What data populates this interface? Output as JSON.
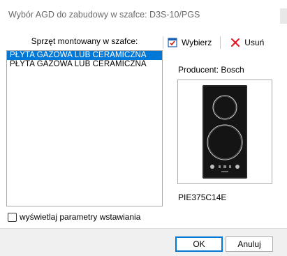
{
  "window": {
    "title": "Wybór AGD do zabudowy w szafce: D3S-10/PGS"
  },
  "left_panel": {
    "header": "Sprzęt montowany w szafce:",
    "items": [
      {
        "label": "PŁYTA GAZOWA LUB CERAMICZNA",
        "selected": true
      },
      {
        "label": "PŁYTA GAZOWA LUB CERAMICZNA",
        "selected": false
      }
    ],
    "checkbox_label": "wyświetlaj parametry wstawiania",
    "checkbox_checked": false
  },
  "toolbar": {
    "select_label": "Wybierz",
    "delete_label": "Usuń"
  },
  "details": {
    "producer": "Producent: Bosch",
    "model": "PIE375C14E"
  },
  "footer": {
    "ok_label": "OK",
    "cancel_label": "Anuluj"
  },
  "colors": {
    "selection": "#0078d7",
    "delete_icon": "#e81123",
    "select_icon": "#1a5fb4"
  }
}
